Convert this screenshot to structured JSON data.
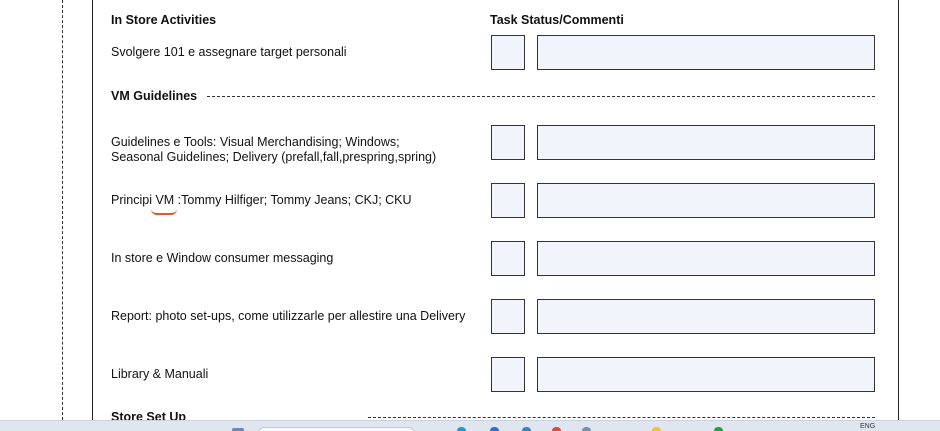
{
  "headers": {
    "section": "In Store Activities",
    "status": "Task Status/Commenti"
  },
  "rows": [
    {
      "label": "Svolgere 101 e assegnare target personali"
    },
    {
      "label_line1": "Guidelines e Tools: Visual Merchandising; Windows;",
      "label_line2": "Seasonal Guidelines; Delivery (prefall,fall,prespring,spring)"
    },
    {
      "label": "Principi VM :Tommy Hilfiger; Tommy Jeans; CKJ; CKU"
    },
    {
      "label": "In store e Window consumer messaging"
    },
    {
      "label": "Report: photo set-ups, come utilizzarle per allestire una Delivery"
    },
    {
      "label": "Library & Manuali"
    }
  ],
  "sections": {
    "vm_guidelines": "VM Guidelines",
    "store_setup": "Store Set Up"
  },
  "taskbar": {
    "lang": "ENG"
  },
  "colors": {
    "box_fill": "#f1f4fb",
    "spellcheck": "#e25b1a"
  }
}
